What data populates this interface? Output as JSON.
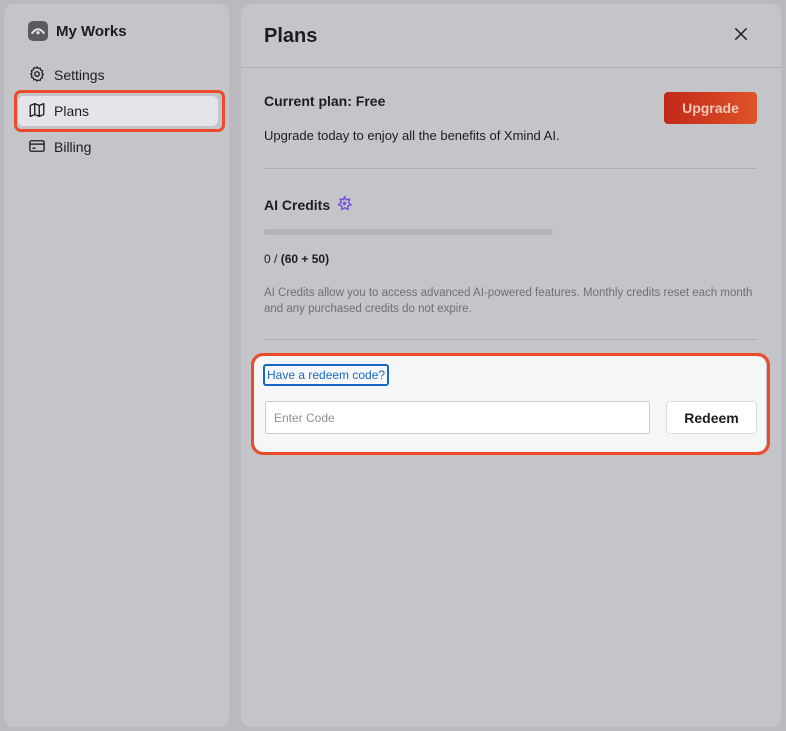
{
  "sidebar": {
    "brand": "My Works",
    "items": [
      {
        "label": "Settings",
        "icon": "gear-icon"
      },
      {
        "label": "Plans",
        "icon": "map-icon",
        "selected": true
      },
      {
        "label": "Billing",
        "icon": "credit-card-icon"
      }
    ]
  },
  "panel": {
    "title": "Plans",
    "close_icon": "close-icon",
    "current_plan": "Current plan: Free",
    "upgrade_label": "Upgrade",
    "upgrade_desc": "Upgrade today to enjoy all the benefits of Xmind AI.",
    "credits_title": "AI Credits",
    "credits_used": "0",
    "credits_separator": " / ",
    "credits_total": "(60 + 50)",
    "credits_progress": 0,
    "credits_note": "AI Credits allow you to access advanced AI-powered features. Monthly credits reset each month and any purchased credits do not expire.",
    "redeem_link": "Have a redeem code?",
    "code_placeholder": "Enter Code",
    "redeem_label": "Redeem"
  },
  "colors": {
    "accent_highlight": "#ec4b2a",
    "upgrade_start": "#c2281a",
    "upgrade_end": "#de5427",
    "link": "#1768c4",
    "ai_icon": "#7a4ee0"
  }
}
